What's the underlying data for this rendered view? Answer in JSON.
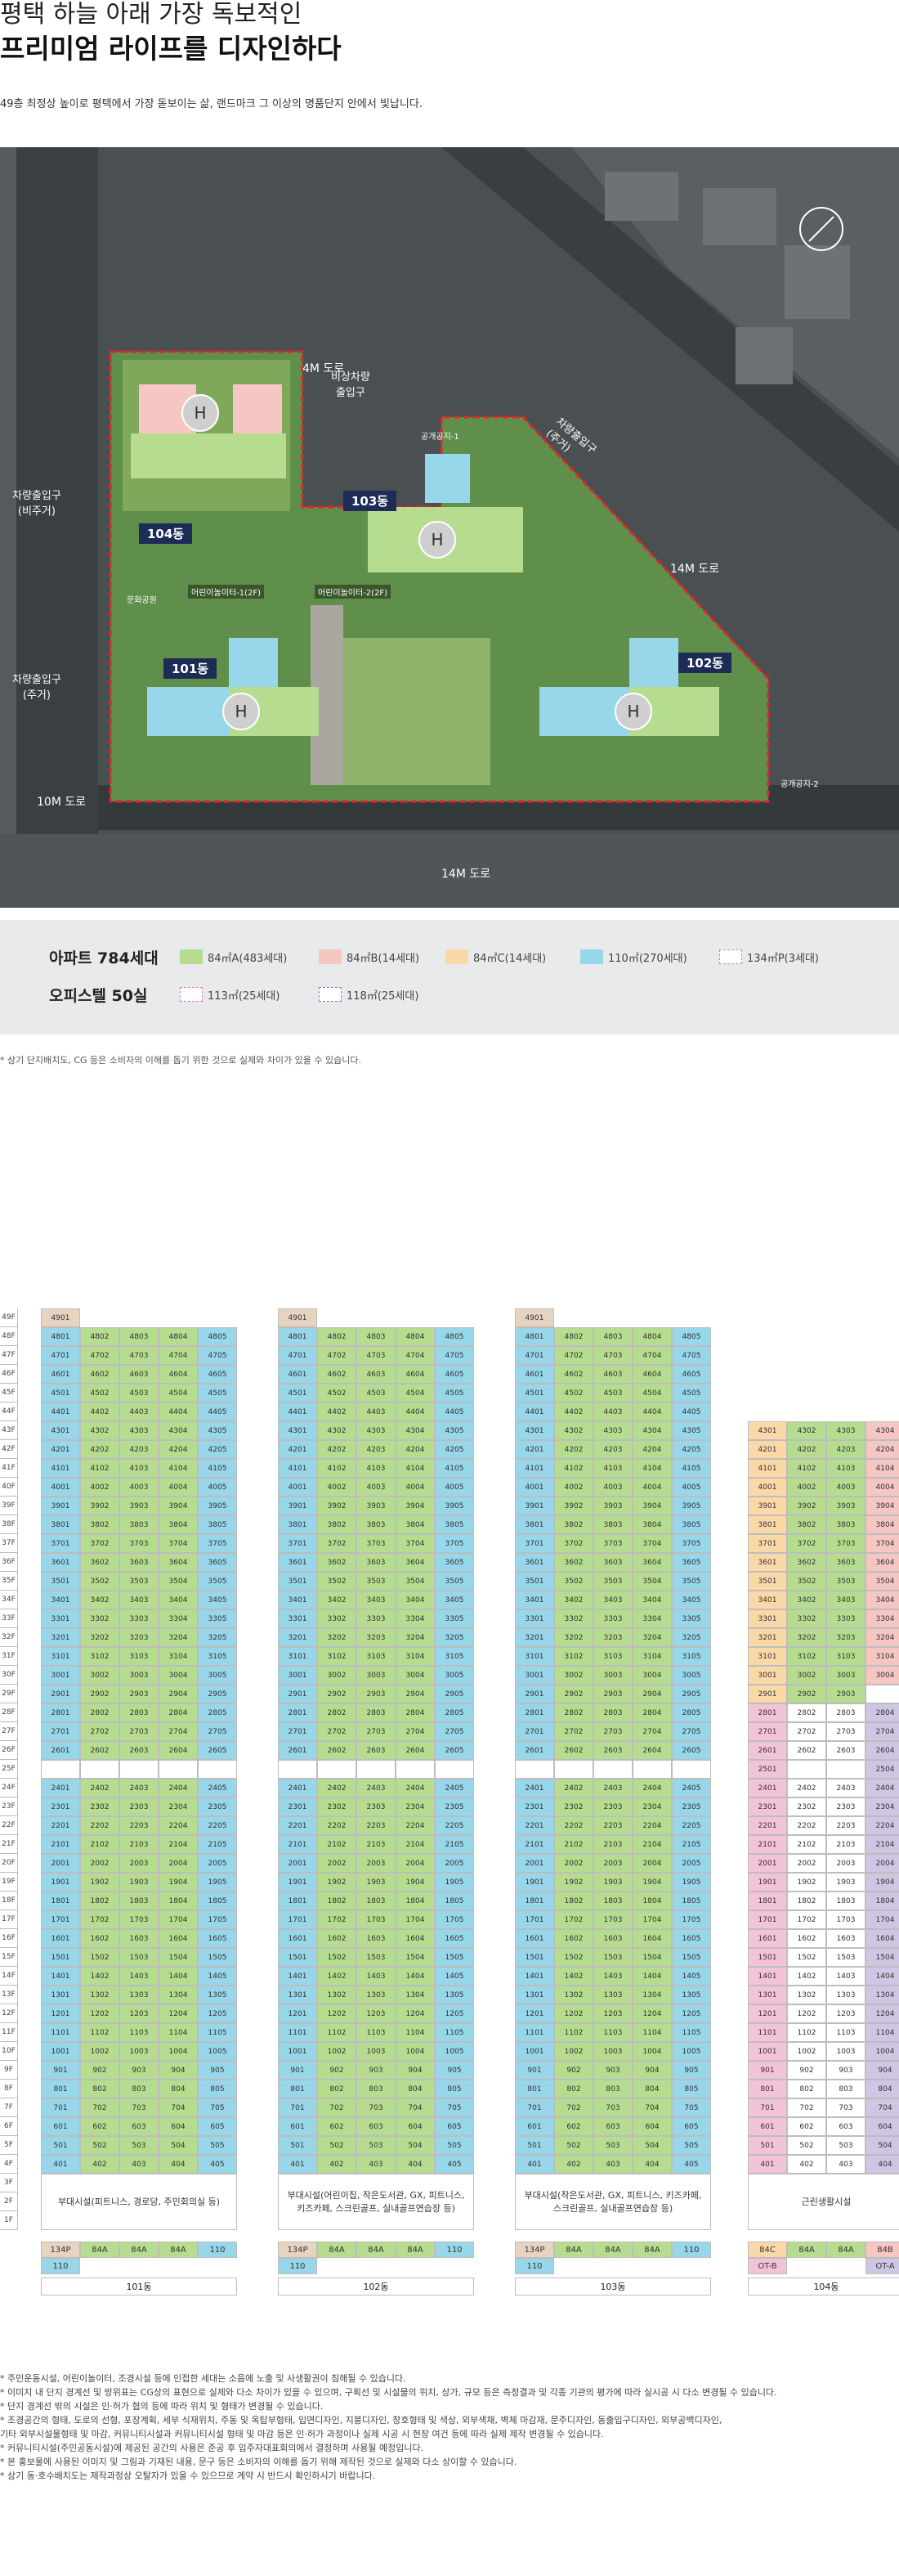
{
  "header": {
    "title_line1": "평택 하늘 아래 가장 독보적인",
    "title_line2": "프리미엄 라이프를 디자인하다",
    "subtitle": "49층 최정상 높이로 평택에서 가장 돋보이는 삶, 랜드마크 그 이상의 명품단지 안에서 빛납니다."
  },
  "map": {
    "road_labels": [
      "4M 도로",
      "14M 도로",
      "10M 도로",
      "14M 도로"
    ],
    "entrance_labels": [
      "비상차량\n출입구",
      "차량출입구\n(주거)",
      "차량출입구\n(비주거)",
      "차량출입구\n(주거)"
    ],
    "building_labels": [
      "104동",
      "103동",
      "101동",
      "102동"
    ],
    "facility_labels": [
      "어린이놀이터-1(2F)",
      "어린이놀이터-2(2F)",
      "공개공지-1",
      "공개공지-2",
      "문화공원"
    ],
    "helipad": "H"
  },
  "legend": {
    "apt_title": "아파트 784세대",
    "off_title": "오피스텔 50실",
    "apt_items": [
      {
        "label": "84㎡A(483세대)",
        "color": "#b6dd8f"
      },
      {
        "label": "84㎡B(14세대)",
        "color": "#f6c6c3"
      },
      {
        "label": "84㎡C(14세대)",
        "color": "#fbd8a8"
      },
      {
        "label": "110㎡(270세대)",
        "color": "#98d6ea"
      },
      {
        "label": "134㎡P(3세대)",
        "color": "#e6d4c0"
      }
    ],
    "off_items": [
      {
        "label": "113㎡(25세대)",
        "color": "#f3c3d8"
      },
      {
        "label": "118㎡(25세대)",
        "color": "#cfc6e4"
      }
    ]
  },
  "note_top": "* 상기 단지배치도, CG 등은 소비자의 이해를 돕기 위한 것으로 실제와 차이가 있을 수 있습니다.",
  "table": {
    "floor_labels": [
      "49F",
      "48F",
      "47F",
      "46F",
      "45F",
      "44F",
      "43F",
      "42F",
      "41F",
      "40F",
      "39F",
      "38F",
      "37F",
      "36F",
      "35F",
      "34F",
      "33F",
      "32F",
      "31F",
      "30F",
      "29F",
      "28F",
      "27F",
      "26F",
      "25F",
      "24F",
      "23F",
      "22F",
      "21F",
      "20F",
      "19F",
      "18F",
      "17F",
      "16F",
      "15F",
      "14F",
      "13F",
      "12F",
      "11F",
      "10F",
      "9F",
      "8F",
      "7F",
      "6F",
      "5F",
      "4F",
      "3F",
      "2F",
      "1F"
    ],
    "buildings": [
      {
        "name": "101동",
        "top_unit": "4901",
        "facility": "부대시설(피트니스, 경로당, 주민회의실 등)",
        "types": [
          "134P",
          "84A",
          "84A",
          "84A",
          "110"
        ],
        "types2": [
          "110"
        ]
      },
      {
        "name": "102동",
        "top_unit": "4901",
        "facility": "부대시설(어린이집, 작은도서관, GX, 피트니스,\n키즈카페, 스크린골프, 실내골프연습장 등)",
        "types": [
          "134P",
          "84A",
          "84A",
          "84A",
          "110"
        ],
        "types2": [
          "110"
        ]
      },
      {
        "name": "103동",
        "top_unit": "4901",
        "facility": "부대시설(작은도서관, GX, 피트니스, 키즈카페,\n스크린골프, 실내골프연습장 등)",
        "types": [
          "134P",
          "84A",
          "84A",
          "84A",
          "110"
        ],
        "types2": [
          "110"
        ]
      },
      {
        "name": "104동",
        "top_unit": "",
        "facility": "근린생활시설",
        "types": [
          "84C",
          "84A",
          "84A",
          "84B"
        ],
        "types2": [
          "OT-B",
          "",
          "",
          "OT-A"
        ]
      }
    ]
  },
  "notes": [
    "* 주민운동시설, 어린이놀이터, 조경시설 등에 인접한 세대는 소음에 노출 및 사생활권이 침해될 수 있습니다.",
    "* 이미지 내 단지 경계선 및 방위표는 CG상의 표현으로 실제와 다소 차이가 있을 수 있으며, 구획선 및 시설물의 위치, 상가, 규모 등은 측정결과 및 각종 기관의 평가에 따라 실시공 시 다소 변경될 수 있습니다.",
    "* 단지 경계선 밖의 시설은 인·허가 협의 등에 따라 위치 및 형태가 변경될 수 있습니다.",
    "* 조경공간의 형태, 도로의 선형, 포장계획, 세부 식재위치, 주동 및 옥탑부형태, 입면디자인, 지붕디자인, 창호형태 및 색상, 외부색채, 벽체 마감재, 문주디자인, 동출입구디자인, 외부공백디자인,",
    "  기타 외부시설물형태 및 마감, 커뮤니티시설과 커뮤니티시설 형태 및 마감 등은 인·허가 과정이나 실제 시공 시 현장 여건 등에 따라 실제 제작 변경될 수 있습니다.",
    "* 커뮤니티시설(주민공동시설)에 제공된 공간의 사용은 준공 후 입주자대표회의에서 결정하며 사용될 예정입니다.",
    "* 본 홍보물에 사용된 이미지 및 그림과 기재된 내용, 문구 등은 소비자의 이해를 돕기 위해 제작된 것으로 실제와 다소 상이할 수 있습니다.",
    "* 상기 동·호수배치도는 제작과정상 오탈자가 있을 수 있으므로 계약 시 반드시 확인하시기 바랍니다."
  ],
  "colors": {
    "green": "#b6dd8f",
    "blue": "#98d6ea",
    "pink": "#f6c6c3",
    "orange": "#fbd8a8",
    "lilac": "#cfc6e4",
    "rose": "#f3c3d8",
    "tan": "#e6d4c0",
    "navy": "#1d2c56",
    "red": "#d9232d"
  }
}
